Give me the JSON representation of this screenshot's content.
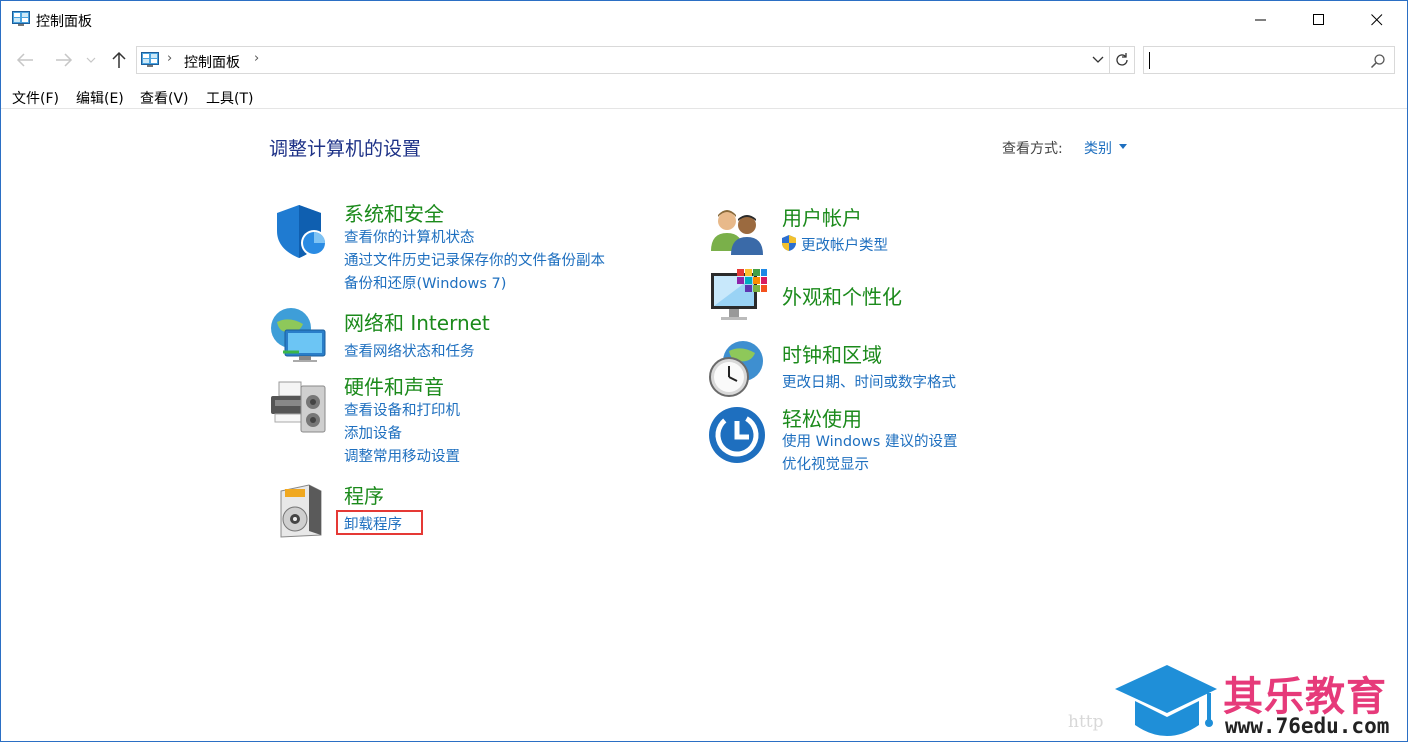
{
  "window": {
    "title": "控制面板"
  },
  "nav": {
    "address_item": "控制面板",
    "search_placeholder": ""
  },
  "menu": [
    "文件(F)",
    "编辑(E)",
    "查看(V)",
    "工具(T)"
  ],
  "content": {
    "heading": "调整计算机的设置",
    "view_by_label": "查看方式:",
    "view_by_value": "类别"
  },
  "categories": {
    "security": {
      "title": "系统和安全",
      "links": [
        "查看你的计算机状态",
        "通过文件历史记录保存你的文件备份副本",
        "备份和还原(Windows 7)"
      ]
    },
    "network": {
      "title": "网络和 Internet",
      "links": [
        "查看网络状态和任务"
      ]
    },
    "hardware": {
      "title": "硬件和声音",
      "links": [
        "查看设备和打印机",
        "添加设备",
        "调整常用移动设置"
      ]
    },
    "programs": {
      "title": "程序",
      "links": [
        "卸载程序"
      ]
    },
    "accounts": {
      "title": "用户帐户",
      "links": [
        "更改帐户类型"
      ]
    },
    "appearance": {
      "title": "外观和个性化",
      "links": []
    },
    "clock": {
      "title": "时钟和区域",
      "links": [
        "更改日期、时间或数字格式"
      ]
    },
    "ease": {
      "title": "轻松使用",
      "links": [
        "使用 Windows 建议的设置",
        "优化视觉显示"
      ]
    }
  },
  "watermark": {
    "http": "http",
    "brand": "其乐教育",
    "url": "www.76edu.com"
  },
  "colors": {
    "title_green": "#1b8a1b",
    "link_blue": "#1e6fbf",
    "heading_blue": "#1e3287",
    "highlight": "#e53935",
    "watermark_pink": "#e63a7a",
    "cap_blue": "#1f8fd8"
  }
}
